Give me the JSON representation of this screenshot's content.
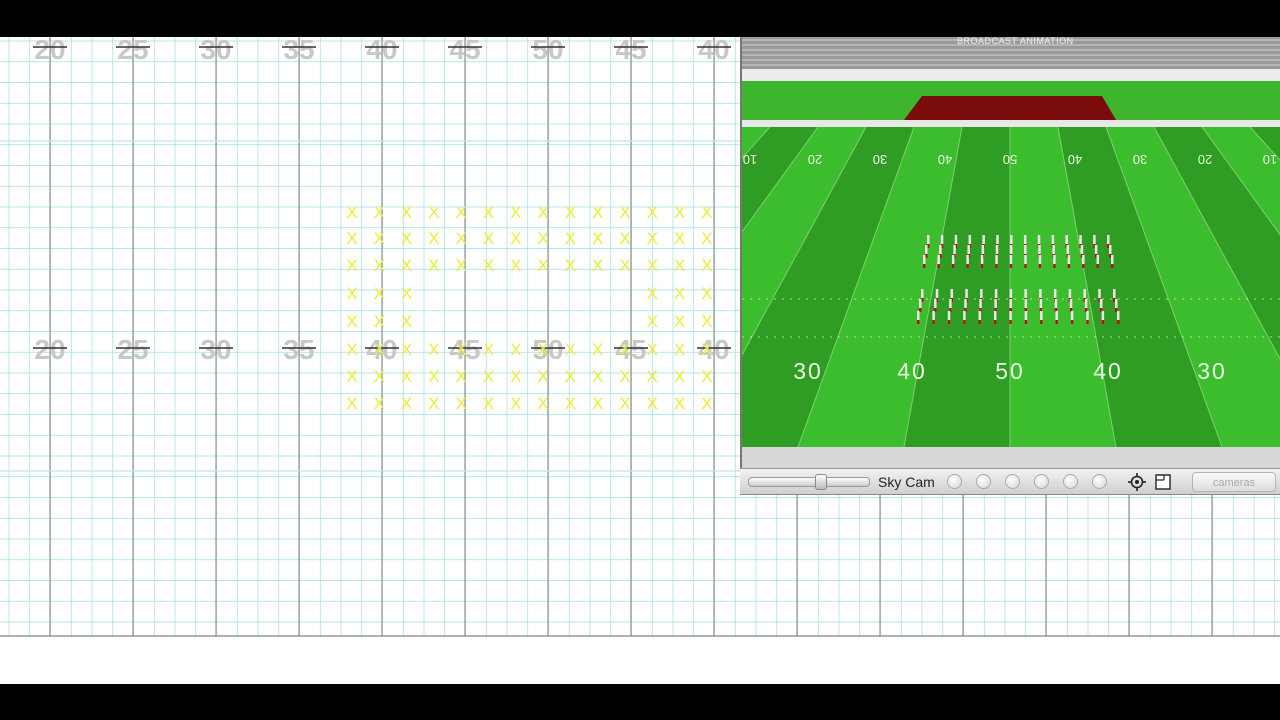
{
  "grid_top_labels": [
    "20",
    "25",
    "30",
    "35",
    "40",
    "45",
    "50",
    "45",
    "40"
  ],
  "grid_mid_labels": [
    "20",
    "25",
    "30",
    "35",
    "40",
    "45",
    "50",
    "45",
    "40"
  ],
  "formation_marker": "X",
  "viewer": {
    "broadcast_text": "BROADCAST ANIMATION",
    "upper_numbers": [
      "10",
      "20",
      "30",
      "40",
      "50",
      "40",
      "30",
      "20",
      "10"
    ],
    "lower_numbers": [
      "30",
      "40",
      "50",
      "40",
      "30"
    ],
    "field_color": "#2f9c23",
    "stripe_color": "#3bbd2d",
    "endzone_color": "#7a0c0c"
  },
  "toolbar": {
    "camera_label": "Sky Cam",
    "cameras_button": "cameras",
    "zoom_level": 0.58,
    "preset_count": 6
  },
  "colors": {
    "grid_minor": "#9fdde6",
    "grid_major": "#8a8a8a",
    "marker": "#ecec3a"
  }
}
